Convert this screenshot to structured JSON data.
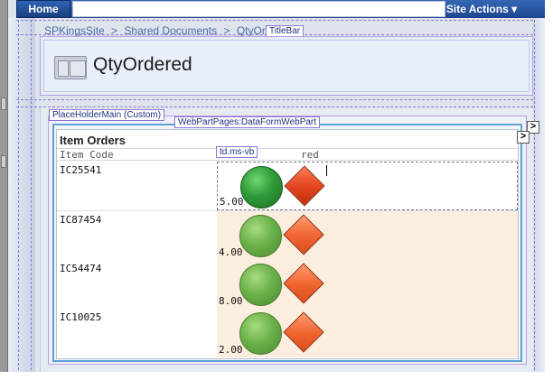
{
  "topbar": {
    "home_label": "Home",
    "site_actions_label": "Site Actions",
    "site_actions_icon": "caret-down-icon"
  },
  "breadcrumb": {
    "items": [
      "SPKingsSite",
      "Shared Documents",
      "QtyOrd"
    ],
    "separator": ">"
  },
  "designer_tags": {
    "titlebar": "TitleBar",
    "placeholder_main": "PlaceHolderMain (Custom)",
    "webpart": "WebPartPages:DataFormWebPart",
    "cell": "td.ms-vb"
  },
  "page": {
    "title": "QtyOrdered",
    "title_icon": "page-layout-icon"
  },
  "table": {
    "heading": "Item Orders",
    "columns": [
      "Item Code",
      "red"
    ],
    "rows": [
      {
        "code": "IC25541",
        "qty": "5.00",
        "style": "dark"
      },
      {
        "code": "IC87454",
        "qty": "4.00",
        "style": "light"
      },
      {
        "code": "IC54474",
        "qty": "8.00",
        "style": "light"
      },
      {
        "code": "IC10025",
        "qty": "2.00",
        "style": "light"
      }
    ],
    "indicator_icons": [
      "green-circle-icon",
      "orange-diamond-icon"
    ]
  },
  "colors": {
    "topbar": "#1c468e",
    "alt_row": "#fbeedf",
    "frame_purple": "#b79de4",
    "webpart_border": "#5da0d6",
    "breadcrumb_text": "#4b6fa8"
  },
  "expand_buttons": {
    "glyph": ">"
  }
}
